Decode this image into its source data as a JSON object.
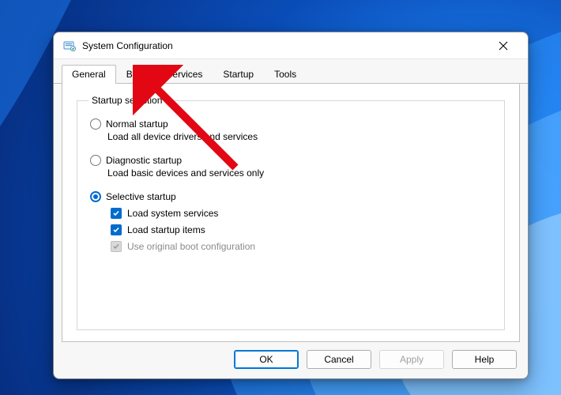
{
  "window": {
    "title": "System Configuration",
    "close_icon_name": "close-icon"
  },
  "tabs": {
    "general": "General",
    "boot": "Boot",
    "services": "Services",
    "startup": "Startup",
    "tools": "Tools",
    "active": "general"
  },
  "general": {
    "groupbox_title": "Startup selection",
    "normal": {
      "label": "Normal startup",
      "desc": "Load all device drivers and services",
      "selected": false
    },
    "diagnostic": {
      "label": "Diagnostic startup",
      "desc": "Load basic devices and services only",
      "selected": false
    },
    "selective": {
      "label": "Selective startup",
      "selected": true,
      "load_system_services": {
        "label": "Load system services",
        "checked": true
      },
      "load_startup_items": {
        "label": "Load startup items",
        "checked": true
      },
      "use_original_boot": {
        "label": "Use original boot configuration",
        "checked": true,
        "disabled": true
      }
    }
  },
  "buttons": {
    "ok": "OK",
    "cancel": "Cancel",
    "apply": "Apply",
    "help": "Help"
  },
  "annotation": {
    "arrow_points_to": "tab-boot",
    "arrow_color": "#e30613"
  }
}
